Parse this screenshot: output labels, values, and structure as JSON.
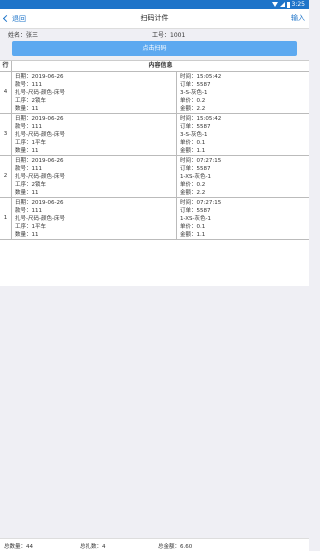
{
  "status_bar": {
    "time": "3:25"
  },
  "navbar": {
    "back_label": "退回",
    "title": "扫码计件",
    "right_label": "输入"
  },
  "info": {
    "name": "姓名：张三",
    "job_no": "工号：1001"
  },
  "scan_button": "点击扫码",
  "table": {
    "headers": [
      "行",
      "内容信息"
    ],
    "rows": [
      {
        "index": "4",
        "left": [
          "日期：2019-06-26",
          "款号：111",
          "扎号-尺码-颜色-床号",
          "工序：2锁车",
          "数量：11"
        ],
        "right": [
          "时间：15:05:42",
          "订单：5587",
          "3-S-灰色-1",
          "单价：0.2",
          "金额：2.2"
        ]
      },
      {
        "index": "3",
        "left": [
          "日期：2019-06-26",
          "款号：111",
          "扎号-尺码-颜色-床号",
          "工序：1平车",
          "数量：11"
        ],
        "right": [
          "时间：15:05:42",
          "订单：5587",
          "3-S-灰色-1",
          "单价：0.1",
          "金额：1.1"
        ]
      },
      {
        "index": "2",
        "left": [
          "日期：2019-06-26",
          "款号：111",
          "扎号-尺码-颜色-床号",
          "工序：2锁车",
          "数量：11"
        ],
        "right": [
          "时间：07:27:15",
          "订单：5587",
          "1-XS-灰色-1",
          "单价：0.2",
          "金额：2.2"
        ]
      },
      {
        "index": "1",
        "left": [
          "日期：2019-06-26",
          "款号：111",
          "扎号-尺码-颜色-床号",
          "工序：1平车",
          "数量：11"
        ],
        "right": [
          "时间：07:27:15",
          "订单：5587",
          "1-XS-灰色-1",
          "单价：0.1",
          "金额：1.1"
        ]
      }
    ]
  },
  "footer": {
    "total_qty": "总数量：44",
    "total_bundles": "总扎数：4",
    "total_amount": "总金额：6.60"
  },
  "colors": {
    "accent": "#1e74c9",
    "button": "#5da9f0"
  }
}
